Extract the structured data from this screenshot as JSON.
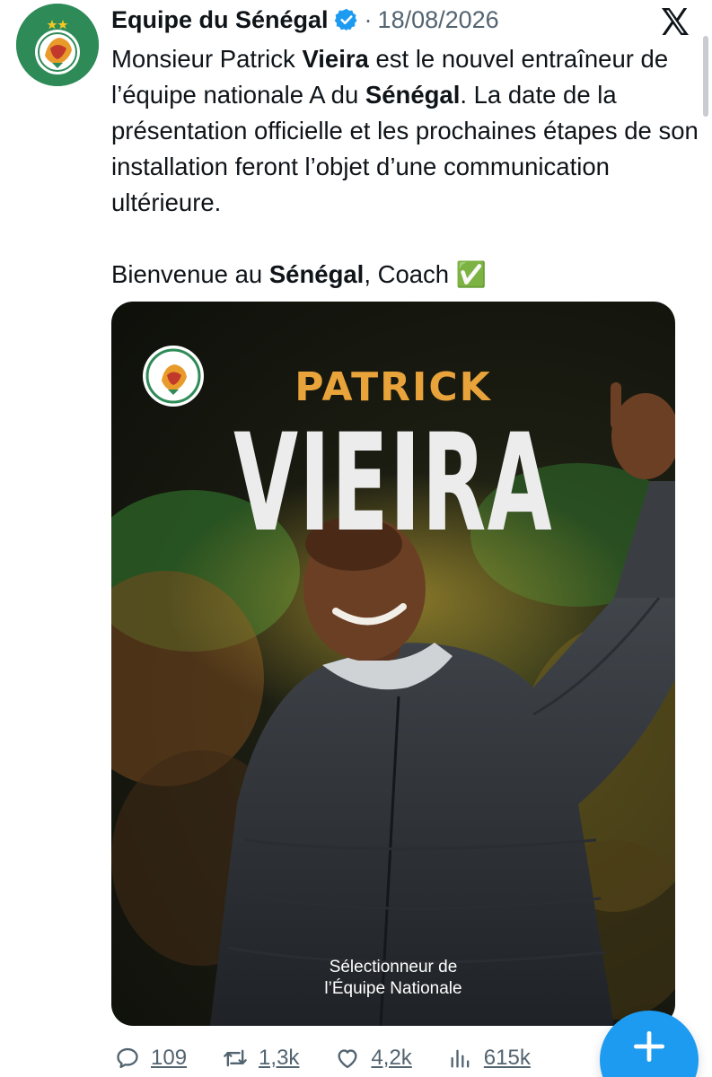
{
  "tweet": {
    "author_name": "Equipe du Sénégal",
    "separator": "·",
    "date": "18/08/2026",
    "paragraph1": [
      {
        "text": "Monsieur Patrick ",
        "bold": false
      },
      {
        "text": "Vieira",
        "bold": true
      },
      {
        "text": " est le nouvel entraîneur de l’équipe nationale A du ",
        "bold": false
      },
      {
        "text": "Sénégal",
        "bold": true
      },
      {
        "text": ". La date de la présentation officielle et les prochaines étapes de son installation feront l’objet d’une communication ultérieure.",
        "bold": false
      }
    ],
    "paragraph2": [
      {
        "text": "Bienvenue au ",
        "bold": false
      },
      {
        "text": "Sénégal",
        "bold": true
      },
      {
        "text": ", Coach ✅",
        "bold": false
      }
    ]
  },
  "poster": {
    "first_name": "PATRICK",
    "last_name": "VIEIRA",
    "caption_line1": "Sélectionneur de",
    "caption_line2": "l’Équipe Nationale"
  },
  "actions": {
    "replies": "109",
    "reposts": "1,3k",
    "likes": "4,2k",
    "views": "615k"
  },
  "icons": {
    "avatar": "senegal-federation-crest",
    "verified": "verified-badge-icon",
    "app": "x-logo-icon",
    "reply": "reply-icon",
    "repost": "repost-icon",
    "like": "heart-icon",
    "views": "views-chart-icon",
    "compose": "plus-icon"
  },
  "colors": {
    "accent": "#1d9bf0",
    "muted": "#536471",
    "poster_first_name": "#e8a33a"
  }
}
